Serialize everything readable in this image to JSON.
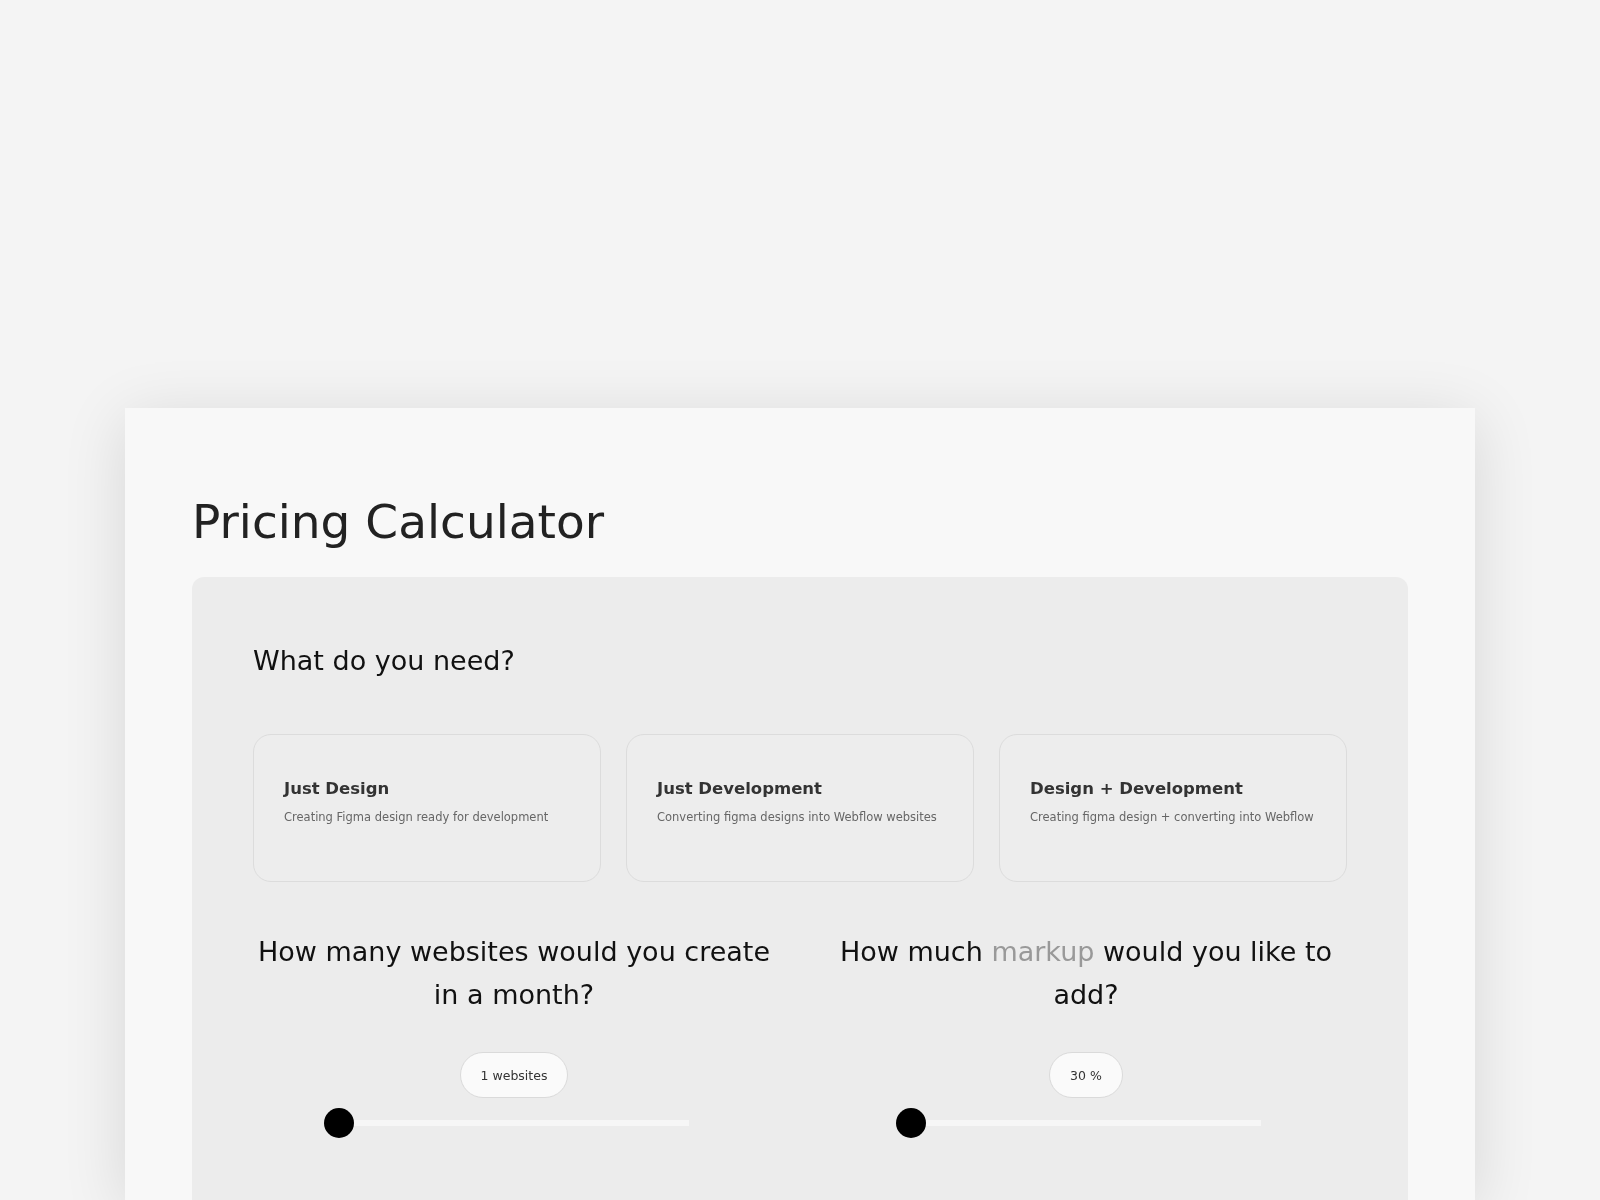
{
  "title": "Pricing Calculator",
  "services": {
    "heading": "What do you need?",
    "options": [
      {
        "name": "Just Design",
        "description": "Creating Figma design ready for development"
      },
      {
        "name": "Just Development",
        "description": "Converting figma designs into Webflow websites"
      },
      {
        "name": "Design + Development",
        "description": "Creating figma design + converting into Webflow"
      }
    ]
  },
  "sliders": [
    {
      "question": [
        {
          "text": "How many websites would you create in a month?",
          "muted": false
        }
      ],
      "reading": "1 websites",
      "level": 0
    },
    {
      "question": [
        {
          "text": "How much ",
          "muted": false
        },
        {
          "text": "markup",
          "muted": true
        },
        {
          "text": " would you like to add?",
          "muted": false
        }
      ],
      "reading": "30 %",
      "level": 0
    }
  ]
}
